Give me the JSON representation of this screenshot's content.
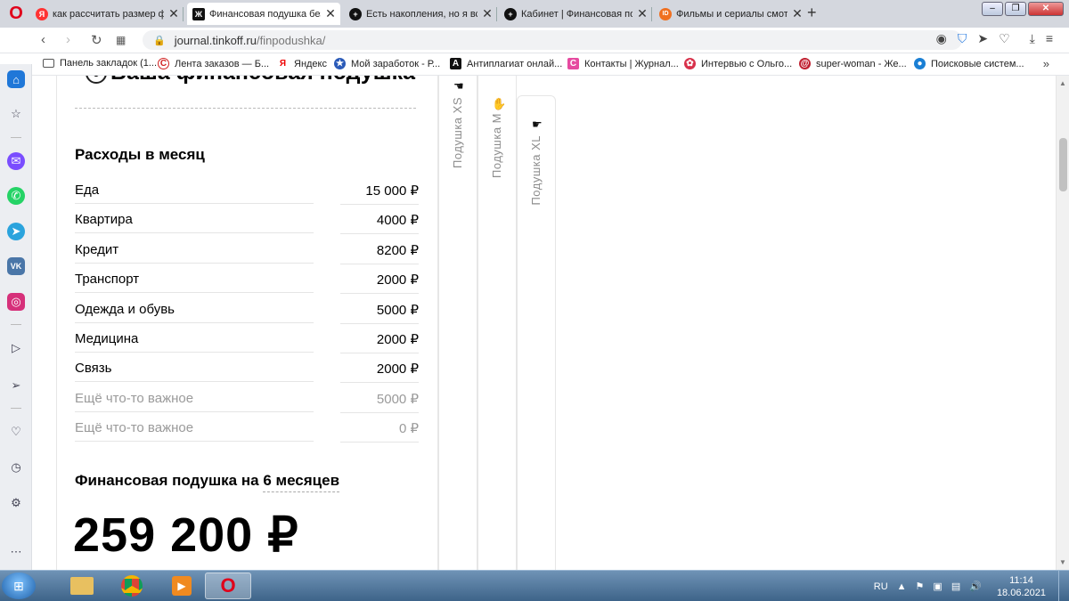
{
  "tabs": [
    {
      "title": "как рассчитать размер фи",
      "fav": "Я",
      "color": "#ff3333"
    },
    {
      "title": "Финансовая подушка без",
      "fav": "Ж",
      "color": "#111111"
    },
    {
      "title": "Есть накопления, но я всё",
      "fav": "+",
      "color": "#111111"
    },
    {
      "title": "Кабинет | Финансовая под",
      "fav": "+",
      "color": "#111111"
    },
    {
      "title": "Фильмы и сериалы смотр",
      "fav": "ID",
      "color": "#f07020"
    }
  ],
  "address": {
    "host": "journal.tinkoff.ru",
    "path": "/finpodushka/"
  },
  "bookmarks": [
    {
      "label": "Панель закладок (1...",
      "icon": "folder-icon"
    },
    {
      "label": "Лента заказов — Б...",
      "icon": "c-icon"
    },
    {
      "label": "Яндекс",
      "icon": "yandex-icon"
    },
    {
      "label": "Мой заработок - Р...",
      "icon": "star-icon"
    },
    {
      "label": "Антиплагиат онлай...",
      "icon": "a-icon"
    },
    {
      "label": "Контакты | Журнал...",
      "icon": "c-pink-icon"
    },
    {
      "label": "Интервью с Ольго...",
      "icon": "flower-icon"
    },
    {
      "label": "super-woman - Же...",
      "icon": "swirl-icon"
    },
    {
      "label": "Поисковые систем...",
      "icon": "drop-icon"
    }
  ],
  "page": {
    "title": "Ваша финансовая подушка",
    "expenses_title": "Расходы в месяц",
    "expenses": [
      {
        "label": "Еда",
        "value": "15 000 ₽",
        "muted": false
      },
      {
        "label": "Квартира",
        "value": "4000 ₽",
        "muted": false
      },
      {
        "label": "Кредит",
        "value": "8200 ₽",
        "muted": false
      },
      {
        "label": "Транспорт",
        "value": "2000 ₽",
        "muted": false
      },
      {
        "label": "Одежда и обувь",
        "value": "5000 ₽",
        "muted": false
      },
      {
        "label": "Медицина",
        "value": "2000 ₽",
        "muted": false
      },
      {
        "label": "Связь",
        "value": "2000 ₽",
        "muted": false
      },
      {
        "label": "Ещё что-то важное",
        "value": "5000 ₽",
        "muted": true
      },
      {
        "label": "Ещё что-то важное",
        "value": "0 ₽",
        "muted": true
      }
    ],
    "cushion_prefix": "Финансовая подушка на",
    "cushion_months": "6 месяцев",
    "total": "259 200 ₽",
    "side_tabs": [
      "Подушка XS",
      "Подушка M",
      "Подушка XL"
    ]
  },
  "taskbar": {
    "lang": "RU",
    "time": "11:14",
    "date": "18.06.2021"
  }
}
